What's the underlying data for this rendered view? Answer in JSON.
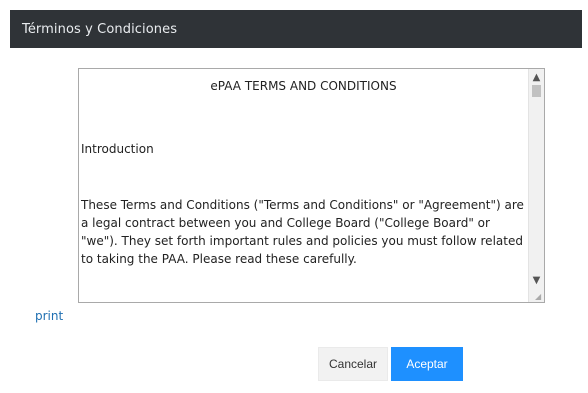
{
  "dialog": {
    "title": "Términos y Condiciones"
  },
  "terms": {
    "heading": "ePAA TERMS AND CONDITIONS",
    "intro_label": "Introduction",
    "paragraph": "These Terms and Conditions (\"Terms and Conditions\" or \"Agreement\") are a legal contract between you and College Board (\"College Board\" or \"we\"). They set forth important rules and policies you must follow related to taking the PAA. Please read these carefully."
  },
  "actions": {
    "print_label": "print",
    "cancel_label": "Cancelar",
    "accept_label": "Aceptar"
  },
  "colors": {
    "titlebar": "#2f3337",
    "accent": "#1e90ff",
    "link": "#1f6fb2"
  },
  "icons": {
    "scroll_up": "chevron-up-icon",
    "scroll_down": "chevron-down-icon",
    "resize": "resize-grip-icon"
  }
}
